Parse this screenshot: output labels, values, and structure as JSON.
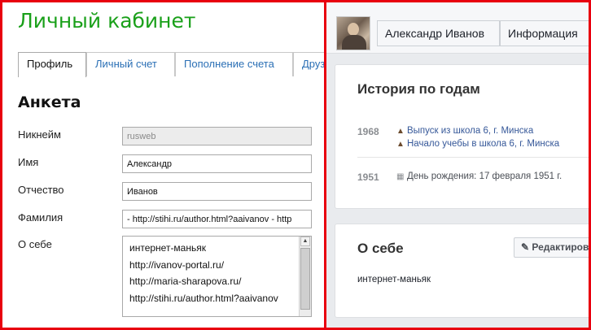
{
  "left": {
    "title": "Личный кабинет",
    "tabs": [
      {
        "label": "Профиль",
        "active": true
      },
      {
        "label": "Личный счет",
        "active": false
      },
      {
        "label": "Пополнение счета",
        "active": false
      },
      {
        "label": "Друз",
        "active": false
      }
    ],
    "section_title": "Анкета",
    "fields": {
      "nickname": {
        "label": "Никнейм",
        "value": "rusweb",
        "disabled": true
      },
      "first_name": {
        "label": "Имя",
        "value": "Александр"
      },
      "patronymic": {
        "label": "Отчество",
        "value": "Иванов"
      },
      "last_name": {
        "label": "Фамилия",
        "value": "- http://stihi.ru/author.html?aaivanov - http"
      },
      "about": {
        "label": "О себе",
        "lines": [
          "интернет-маньяк",
          "http://ivanov-portal.ru/",
          "http://maria-sharapova.ru/",
          "http://stihi.ru/author.html?aaivanov"
        ]
      }
    }
  },
  "right": {
    "profile_name": "Александр Иванов",
    "info_button": "Информация",
    "history": {
      "title": "История по годам",
      "groups": [
        {
          "year": "1968",
          "events": [
            {
              "icon": "graduation-cap-icon",
              "text": "Выпуск из школа 6, г. Минска"
            },
            {
              "icon": "graduation-cap-icon",
              "text": "Начало учебы в школа 6, г. Минска"
            }
          ]
        },
        {
          "year": "1951",
          "events": [
            {
              "icon": "calendar-icon",
              "text": "День рождения: 17 февраля 1951 г."
            }
          ]
        }
      ]
    },
    "about": {
      "title": "О себе",
      "edit_button": "Редактиров",
      "text": "интернет-маньяк"
    }
  },
  "colors": {
    "frame_border": "#e8000f",
    "title_green": "#1aa01a",
    "link_blue": "#365899",
    "tab_link": "#2a6fb5"
  }
}
